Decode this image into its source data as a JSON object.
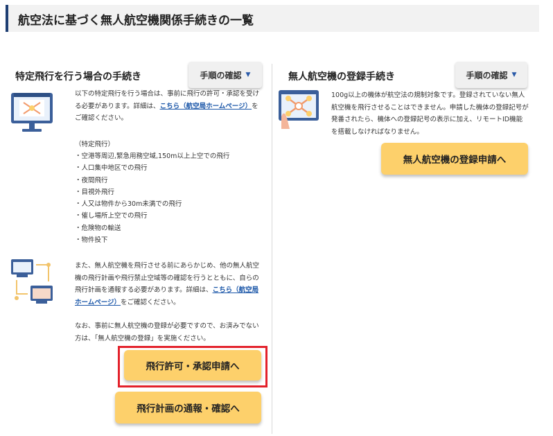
{
  "page": {
    "title": "航空法に基づく無人航空機関係手続きの一覧"
  },
  "left": {
    "title": "特定飛行を行う場合の手続き",
    "step_button": "手順の確認",
    "intro": {
      "before_link": "以下の特定飛行を行う場合は、事前に飛行の許可・承認を受ける必要があります。詳細は、",
      "link": "こちら（航空局ホームページ）",
      "after_link": "をご確認ください。"
    },
    "list_heading": "（特定飛行）",
    "list_items": [
      "・空港等周辺,緊急用務空域,150m以上上空での飛行",
      "・人口集中地区での飛行",
      "・夜間飛行",
      "・目視外飛行",
      "・人又は物件から30m未満での飛行",
      "・催し場所上空での飛行",
      "・危険物の輸送",
      "・物件投下"
    ],
    "plan": {
      "before_link": "また、無人航空機を飛行させる前にあらかじめ、他の無人航空機の飛行計画や飛行禁止空域等の確認を行うとともに、自らの飛行計画を通報する必要があります。詳細は、",
      "link": "こちら（航空局ホームページ）",
      "after_link": "をご確認ください。"
    },
    "note": "なお、事前に無人航空機の登録が必要ですので、お済みでない方は、「無人航空機の登録」を実施ください。",
    "permit_button": "飛行許可・承認申請へ",
    "plan_button": "飛行計画の通報・確認へ"
  },
  "right": {
    "title": "無人航空機の登録手続き",
    "step_button": "手順の確認",
    "desc": "100g以上の機体が航空法の規制対象です。登録されていない無人航空機を飛行させることはできません。申請した機体の登録記号が発番されたら、機体への登録記号の表示に加え、リモートID機能を搭載しなければなりません。",
    "register_button": "無人航空機の登録申請へ"
  }
}
